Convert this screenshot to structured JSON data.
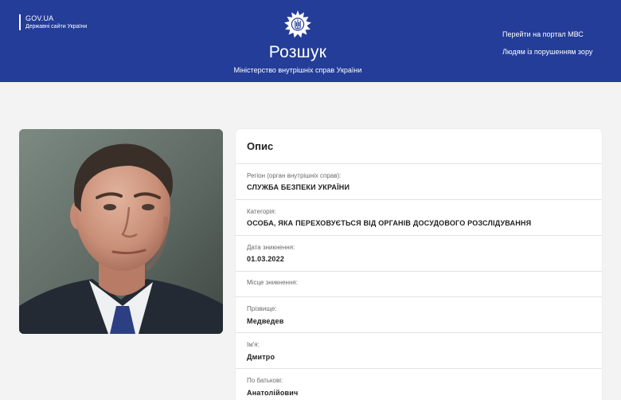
{
  "header": {
    "gov_title": "GOV.UA",
    "gov_subtitle": "Державні сайти України",
    "title": "Розшук",
    "subtitle": "Міністерство внутрішніх справ України",
    "emblem_icon": "ministry-emblem-icon",
    "nav": [
      "Перейти на портал МВС",
      "Людям із порушенням зору"
    ],
    "background_color": "#233d98"
  },
  "photo": {
    "icon": "portrait-photo"
  },
  "description": {
    "title": "Опис",
    "fields": [
      {
        "label": "Регіон (орган внутрішніх справ):",
        "value": "СЛУЖБА БЕЗПЕКИ УКРАЇНИ"
      },
      {
        "label": "Категорія:",
        "value": "ОСОБА, ЯКА ПЕРЕХОВУЄТЬСЯ ВІД ОРГАНІВ ДОСУДОВОГО РОЗСЛІДУВАННЯ"
      },
      {
        "label": "Дата зникнення:",
        "value": "01.03.2022"
      },
      {
        "label": "Місце зникнення:",
        "value": ""
      },
      {
        "label": "Прізвище:",
        "value": "Медведев"
      },
      {
        "label": "Ім'я:",
        "value": "Дмитро"
      },
      {
        "label": "По батькові:",
        "value": "Анатолійович"
      }
    ]
  }
}
